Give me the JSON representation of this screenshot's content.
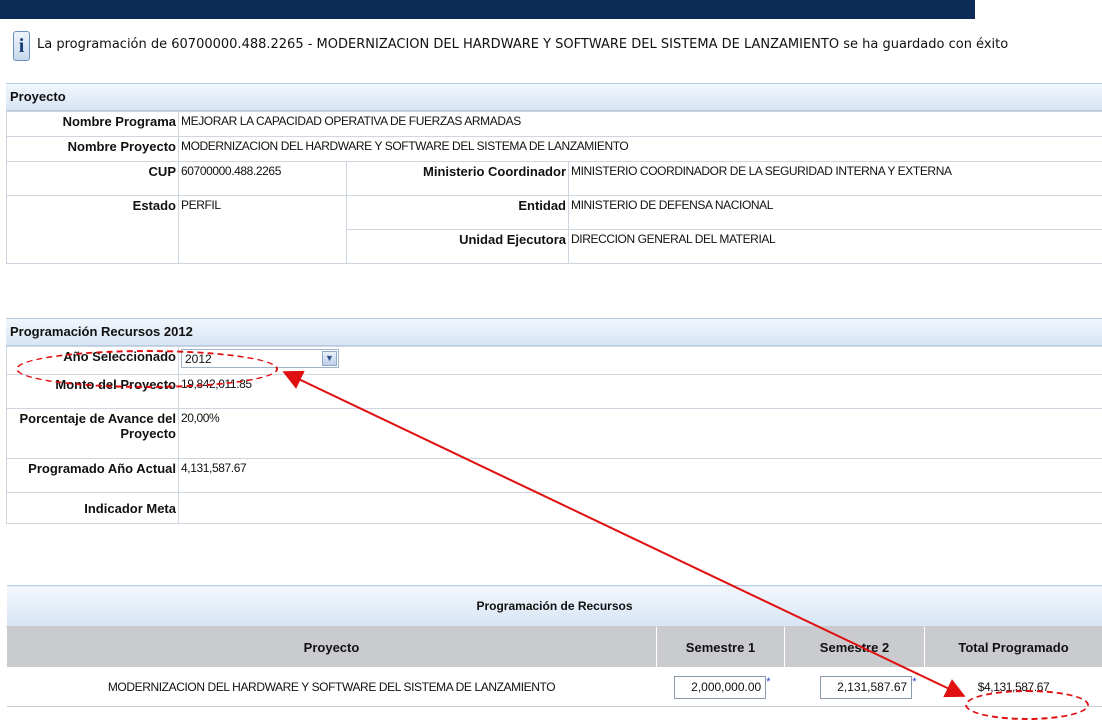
{
  "message": {
    "icon": "info-icon",
    "text": "La programación de 60700000.488.2265 - MODERNIZACION DEL HARDWARE Y SOFTWARE DEL SISTEMA DE LANZAMIENTO se ha guardado con éxito"
  },
  "proyecto": {
    "header": "Proyecto",
    "nombre_programa_label": "Nombre Programa",
    "nombre_programa": "MEJORAR LA CAPACIDAD OPERATIVA DE FUERZAS ARMADAS",
    "nombre_proyecto_label": "Nombre Proyecto",
    "nombre_proyecto": "MODERNIZACION DEL HARDWARE Y SOFTWARE DEL SISTEMA DE LANZAMIENTO",
    "cup_label": "CUP",
    "cup": "60700000.488.2265",
    "ministerio_label": "Ministerio Coordinador",
    "ministerio": "MINISTERIO COORDINADOR DE LA SEGURIDAD INTERNA Y EXTERNA",
    "estado_label": "Estado",
    "estado": "PERFIL",
    "entidad_label": "Entidad",
    "entidad": "MINISTERIO DE DEFENSA NACIONAL",
    "unidad_label": "Unidad Ejecutora",
    "unidad": "DIRECCION GENERAL DEL MATERIAL"
  },
  "programacion": {
    "header": "Programación Recursos 2012",
    "anio_label": "Año Seleccionado",
    "anio_value": "2012",
    "monto_label": "Monto del Proyecto",
    "monto": "19,842,011.85",
    "avance_label_1": "Porcentaje de Avance del",
    "avance_label_2": "Proyecto",
    "avance": "20,00%",
    "programado_label": "Programado Año Actual",
    "programado": "4,131,587.67",
    "indicador_label": "Indicador Meta",
    "indicador": ""
  },
  "recursos": {
    "title": "Programación de Recursos",
    "columns": [
      "Proyecto",
      "Semestre 1",
      "Semestre 2",
      "Total Programado"
    ],
    "rows": [
      {
        "proyecto": "MODERNIZACION DEL HARDWARE Y SOFTWARE DEL SISTEMA DE LANZAMIENTO",
        "semestre1": "2,000,000.00",
        "semestre2": "2,131,587.67",
        "total": "$4,131,587.67",
        "required_mark": "*"
      }
    ]
  },
  "annotation_color": "#e01010"
}
